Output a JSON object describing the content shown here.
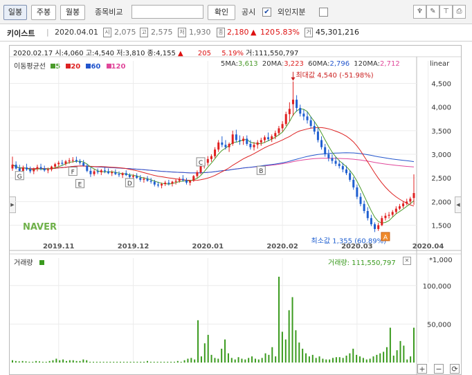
{
  "toolbar": {
    "tabs": [
      {
        "label": "일봉",
        "active": true
      },
      {
        "label": "주봉",
        "active": false
      },
      {
        "label": "월봉",
        "active": false
      }
    ],
    "compare_label": "종목비교",
    "compare_value": "",
    "confirm_label": "확인",
    "disclosure_label": "공시",
    "disclosure_checked": "✔",
    "foreign_label": "외인지분",
    "foreign_checked": ""
  },
  "stock": {
    "name": "키이스트",
    "date": "2020.04.01",
    "open_icon": "시",
    "open": "2,075",
    "high_icon": "고",
    "high": "2,575",
    "low_icon": "저",
    "low": "1,930",
    "close_icon": "종",
    "close": "2,180",
    "change_arrow": "▲",
    "change": "120",
    "change_pct": "5.83%",
    "volume_icon": "거",
    "volume": "45,301,216"
  },
  "ohlc_row": {
    "date": "2020.02.17",
    "open": "시:4,060",
    "high": "고:4,540",
    "low": "저:3,810",
    "close": "종:4,155",
    "arrow": "▲",
    "change": "205",
    "pct": "5.19%",
    "volume": "거:111,550,797"
  },
  "ma_legend": {
    "title": "이동평균선",
    "periods": [
      {
        "label": "5",
        "color": "#4a9a2a"
      },
      {
        "label": "20",
        "color": "#d22"
      },
      {
        "label": "60",
        "color": "#2255cc"
      },
      {
        "label": "120",
        "color": "#e0479a"
      }
    ]
  },
  "ma_values": [
    {
      "label": "5MA:",
      "value": "3,613",
      "color": "#4a9a2a"
    },
    {
      "label": "20MA:",
      "value": "3,223",
      "color": "#d22"
    },
    {
      "label": "60MA:",
      "value": "2,796",
      "color": "#2255cc"
    },
    {
      "label": "120MA:",
      "value": "2,712",
      "color": "#e0479a"
    }
  ],
  "scale_label": "linear",
  "colors": {
    "up": "#e02020",
    "down": "#1f5fd0",
    "volume": "#3a9a1e",
    "ma5": "#4a9a2a",
    "ma20": "#d22",
    "ma60": "#2255cc",
    "ma120": "#e0479a"
  },
  "chart_data": [
    {
      "type": "candlestick",
      "title": "",
      "xlabel": "",
      "ylabel": "",
      "ylim": [
        1200,
        4800
      ],
      "yticks": [
        1500,
        2000,
        2500,
        3000,
        3500,
        4000,
        4500
      ],
      "ytick_labels": [
        "1,500",
        "2,000",
        "2,500",
        "3,000",
        "3,500",
        "4,000",
        "4,500"
      ],
      "xtick_labels": [
        "2019.11",
        "2019.12",
        "2020.01",
        "2020.02",
        "2020.03",
        "2020.04"
      ],
      "xtick_index": [
        13,
        34,
        55,
        76,
        97,
        117
      ],
      "grid": true,
      "candles": [
        [
          2700,
          2950,
          2650,
          2780
        ],
        [
          2780,
          2850,
          2680,
          2700
        ],
        [
          2700,
          2780,
          2600,
          2650
        ],
        [
          2650,
          2760,
          2600,
          2720
        ],
        [
          2720,
          2800,
          2650,
          2680
        ],
        [
          2680,
          2740,
          2600,
          2640
        ],
        [
          2640,
          2720,
          2580,
          2690
        ],
        [
          2690,
          2780,
          2640,
          2730
        ],
        [
          2730,
          2800,
          2660,
          2700
        ],
        [
          2700,
          2760,
          2630,
          2660
        ],
        [
          2660,
          2720,
          2600,
          2680
        ],
        [
          2680,
          2760,
          2640,
          2740
        ],
        [
          2740,
          2820,
          2700,
          2790
        ],
        [
          2790,
          2860,
          2740,
          2820
        ],
        [
          2820,
          2880,
          2760,
          2800
        ],
        [
          2800,
          2880,
          2760,
          2850
        ],
        [
          2850,
          2920,
          2800,
          2870
        ],
        [
          2870,
          2940,
          2820,
          2880
        ],
        [
          2880,
          2950,
          2820,
          2850
        ],
        [
          2850,
          2900,
          2780,
          2820
        ],
        [
          2820,
          2880,
          2740,
          2760
        ],
        [
          2760,
          2800,
          2620,
          2650
        ],
        [
          2650,
          2720,
          2520,
          2580
        ],
        [
          2580,
          2680,
          2540,
          2640
        ],
        [
          2640,
          2700,
          2580,
          2620
        ],
        [
          2620,
          2690,
          2560,
          2660
        ],
        [
          2660,
          2720,
          2600,
          2640
        ],
        [
          2640,
          2700,
          2580,
          2600
        ],
        [
          2600,
          2660,
          2540,
          2620
        ],
        [
          2620,
          2680,
          2560,
          2580
        ],
        [
          2580,
          2640,
          2520,
          2560
        ],
        [
          2560,
          2620,
          2500,
          2600
        ],
        [
          2600,
          2660,
          2540,
          2560
        ],
        [
          2560,
          2600,
          2480,
          2520
        ],
        [
          2520,
          2580,
          2460,
          2540
        ],
        [
          2540,
          2600,
          2480,
          2500
        ],
        [
          2500,
          2560,
          2420,
          2460
        ],
        [
          2460,
          2520,
          2400,
          2480
        ],
        [
          2480,
          2540,
          2420,
          2440
        ],
        [
          2440,
          2500,
          2380,
          2420
        ],
        [
          2420,
          2460,
          2320,
          2360
        ],
        [
          2360,
          2420,
          2300,
          2340
        ],
        [
          2340,
          2400,
          2280,
          2370
        ],
        [
          2370,
          2440,
          2330,
          2400
        ],
        [
          2400,
          2460,
          2340,
          2380
        ],
        [
          2380,
          2440,
          2320,
          2420
        ],
        [
          2420,
          2480,
          2360,
          2440
        ],
        [
          2440,
          2520,
          2400,
          2480
        ],
        [
          2480,
          2560,
          2420,
          2450
        ],
        [
          2450,
          2500,
          2360,
          2400
        ],
        [
          2400,
          2460,
          2340,
          2440
        ],
        [
          2440,
          2560,
          2420,
          2540
        ],
        [
          2540,
          2660,
          2500,
          2620
        ],
        [
          2620,
          2800,
          2580,
          2760
        ],
        [
          2760,
          2900,
          2700,
          2820
        ],
        [
          2820,
          2960,
          2760,
          2900
        ],
        [
          2900,
          3000,
          2840,
          2960
        ],
        [
          2960,
          3150,
          2920,
          3100
        ],
        [
          3100,
          3300,
          3050,
          3250
        ],
        [
          3250,
          3380,
          3150,
          3200
        ],
        [
          3200,
          3300,
          3100,
          3150
        ],
        [
          3150,
          3250,
          3050,
          3220
        ],
        [
          3220,
          3500,
          3180,
          3420
        ],
        [
          3420,
          3520,
          3250,
          3300
        ],
        [
          3300,
          3400,
          3200,
          3280
        ],
        [
          3280,
          3380,
          3200,
          3330
        ],
        [
          3330,
          3400,
          3180,
          3220
        ],
        [
          3220,
          3300,
          3100,
          3150
        ],
        [
          3150,
          3260,
          3080,
          3200
        ],
        [
          3200,
          3300,
          3120,
          3250
        ],
        [
          3250,
          3350,
          3180,
          3300
        ],
        [
          3300,
          3400,
          3240,
          3360
        ],
        [
          3360,
          3460,
          3280,
          3320
        ],
        [
          3320,
          3420,
          3260,
          3380
        ],
        [
          3380,
          3500,
          3320,
          3450
        ],
        [
          3450,
          3600,
          3400,
          3550
        ],
        [
          3550,
          3700,
          3480,
          3640
        ],
        [
          3640,
          3900,
          3600,
          3850
        ],
        [
          3850,
          4100,
          3700,
          3960
        ],
        [
          4060,
          4540,
          3810,
          4155
        ],
        [
          4155,
          4250,
          3900,
          3980
        ],
        [
          3980,
          4050,
          3800,
          3860
        ],
        [
          3860,
          3950,
          3720,
          3800
        ],
        [
          3800,
          3900,
          3650,
          3720
        ],
        [
          3720,
          3800,
          3550,
          3600
        ],
        [
          3600,
          3700,
          3420,
          3480
        ],
        [
          3480,
          3560,
          3250,
          3300
        ],
        [
          3300,
          3380,
          3100,
          3150
        ],
        [
          3150,
          3220,
          2950,
          3000
        ],
        [
          3000,
          3100,
          2850,
          2920
        ],
        [
          2920,
          3000,
          2800,
          2860
        ],
        [
          2860,
          2950,
          2750,
          2800
        ],
        [
          2800,
          2880,
          2700,
          2750
        ],
        [
          2750,
          2820,
          2620,
          2680
        ],
        [
          2680,
          2760,
          2560,
          2600
        ],
        [
          2600,
          2660,
          2420,
          2460
        ],
        [
          2460,
          2520,
          2250,
          2300
        ],
        [
          2300,
          2360,
          2050,
          2100
        ],
        [
          2100,
          2180,
          1900,
          1950
        ],
        [
          1950,
          2020,
          1750,
          1800
        ],
        [
          1800,
          1880,
          1600,
          1650
        ],
        [
          1650,
          1720,
          1480,
          1520
        ],
        [
          1520,
          1560,
          1355,
          1420
        ],
        [
          1420,
          1550,
          1380,
          1500
        ],
        [
          1500,
          1700,
          1480,
          1650
        ],
        [
          1650,
          1760,
          1600,
          1700
        ],
        [
          1700,
          1780,
          1640,
          1720
        ],
        [
          1720,
          1820,
          1680,
          1780
        ],
        [
          1780,
          1900,
          1740,
          1850
        ],
        [
          1850,
          1950,
          1820,
          1900
        ],
        [
          1900,
          2000,
          1860,
          1960
        ],
        [
          1960,
          2060,
          1920,
          2000
        ],
        [
          2000,
          2100,
          1950,
          2060
        ],
        [
          2075,
          2575,
          1930,
          2180
        ]
      ],
      "ma5_last": "3,613",
      "annotations": [
        {
          "text": "최대값 4,540 (-51.98%)",
          "index": 79,
          "price": 4540
        },
        {
          "text": "최소값 1,355 (60.89%)",
          "index": 106,
          "price": 1355
        }
      ],
      "event_markers": [
        {
          "label": "G",
          "index": 2,
          "price": 2550
        },
        {
          "label": "F",
          "index": 17,
          "price": 2640
        },
        {
          "label": "E",
          "index": 19,
          "price": 2380
        },
        {
          "label": "D",
          "index": 33,
          "price": 2400
        },
        {
          "label": "C",
          "index": 53,
          "price": 2840
        },
        {
          "label": "B",
          "index": 70,
          "price": 2660
        },
        {
          "label": "A",
          "index": 105,
          "price": 1260
        }
      ],
      "watermark": "NAVER"
    },
    {
      "type": "bar",
      "title": "거래량",
      "series": [
        {
          "name": "거래량",
          "values": [
            3,
            2,
            1.5,
            2,
            1.5,
            1,
            1,
            2,
            1.5,
            1,
            1,
            2,
            3,
            5,
            3,
            4,
            2,
            3,
            3,
            2,
            2,
            4,
            3,
            1,
            1,
            1,
            1,
            1,
            1,
            1,
            1,
            1,
            1,
            1,
            1,
            1,
            1,
            1,
            1,
            1,
            2,
            1,
            1,
            1,
            1,
            1,
            1,
            1,
            1,
            2,
            1,
            3,
            5,
            6,
            4,
            55,
            8,
            25,
            36,
            10,
            6,
            5,
            18,
            30,
            12,
            6,
            4,
            7,
            5,
            4,
            6,
            8,
            5,
            4,
            6,
            12,
            10,
            20,
            8,
            111.55,
            40,
            30,
            68,
            85,
            42,
            26,
            18,
            12,
            8,
            10,
            6,
            8,
            5,
            4,
            4,
            6,
            7,
            7,
            6,
            9,
            12,
            18,
            10,
            8,
            6,
            4,
            5,
            8,
            10,
            12,
            14,
            20,
            45.3,
            9,
            16,
            28,
            22,
            4,
            8,
            45.3
          ]
        }
      ],
      "ylim": [
        0,
        125
      ],
      "yticks": [
        50,
        100
      ],
      "ytick_labels": [
        "50,000",
        "100,000"
      ],
      "unit": "*1,000",
      "last_value_label": "거래량: 111,550,797"
    }
  ]
}
